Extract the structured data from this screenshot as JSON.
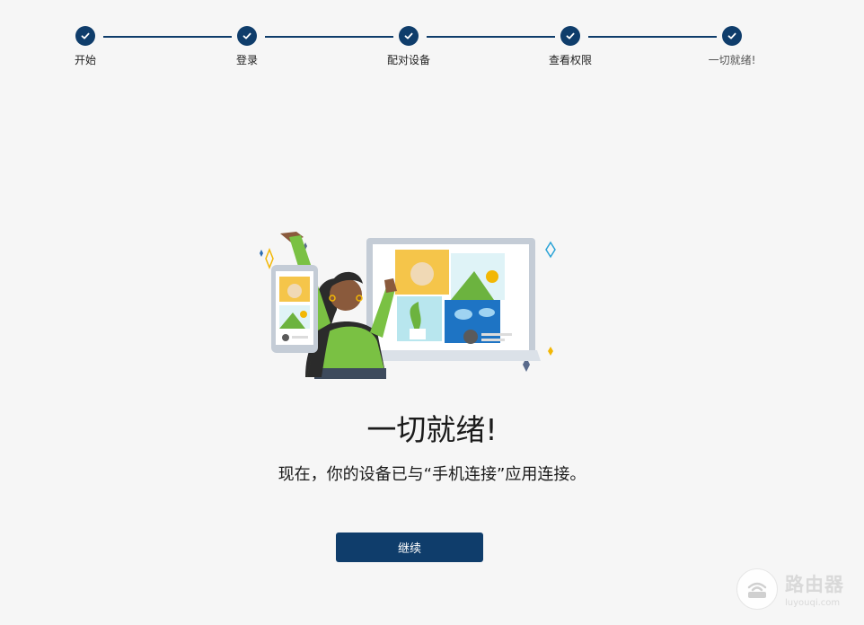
{
  "stepper": {
    "steps": [
      {
        "label": "开始"
      },
      {
        "label": "登录"
      },
      {
        "label": "配对设备"
      },
      {
        "label": "查看权限"
      },
      {
        "label": "一切就绪!"
      }
    ],
    "step_icon": "checkmark-icon",
    "accent_color": "#0f3d6b"
  },
  "main": {
    "title": "一切就绪!",
    "subtitle": "现在，你的设备已与“手机连接”应用连接。",
    "continue_label": "继续",
    "illustration_icon": "phone-laptop-connected-illustration"
  },
  "watermark": {
    "name": "路由器",
    "site": "luyouqi.com"
  }
}
